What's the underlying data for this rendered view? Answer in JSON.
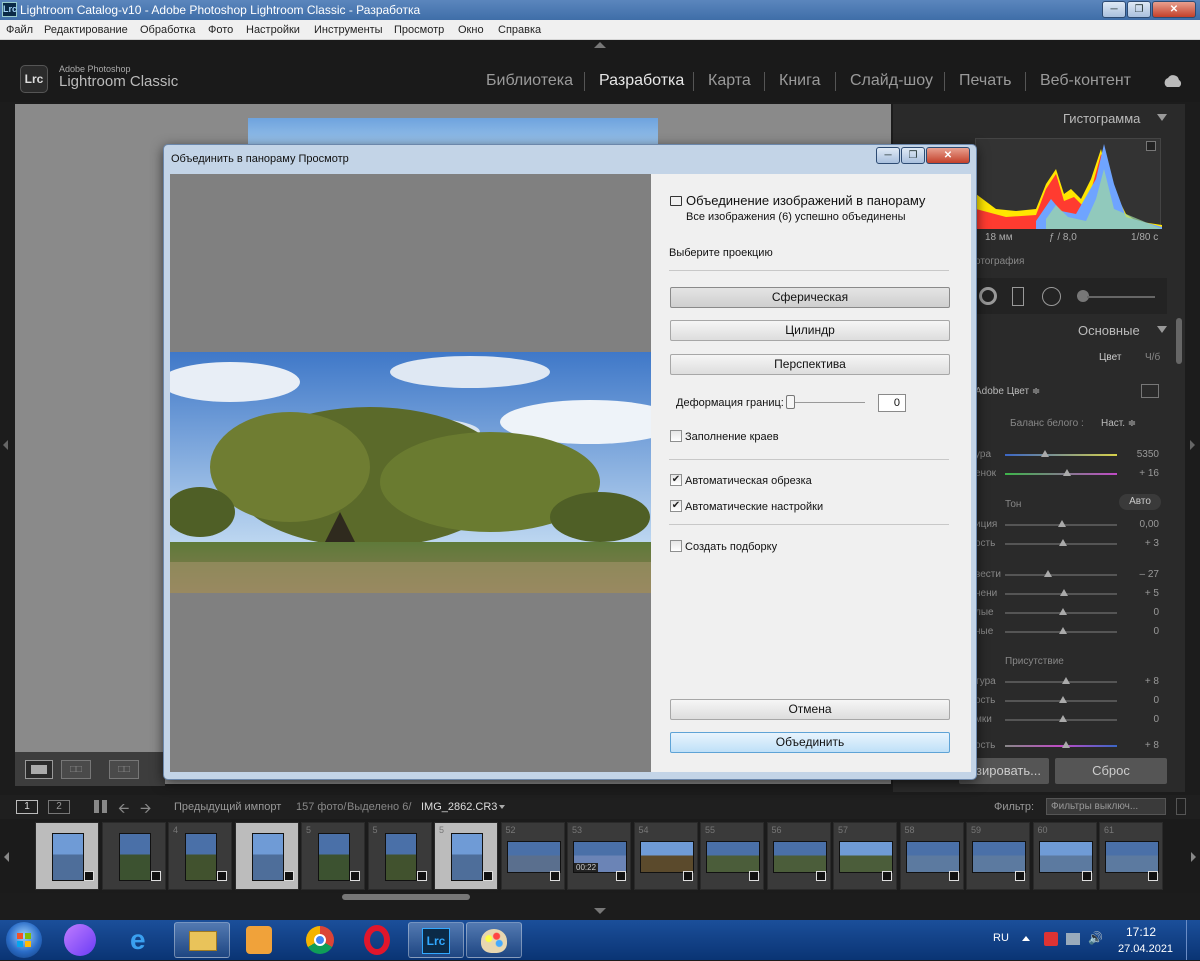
{
  "window": {
    "title": "Lightroom Catalog-v10 - Adobe Photoshop Lightroom Classic - Разработка",
    "app_icon": "Lrc",
    "controls": [
      "minimize",
      "maximize",
      "close"
    ]
  },
  "menu": [
    "Файл",
    "Редактирование",
    "Обработка",
    "Фото",
    "Настройки",
    "Инструменты",
    "Просмотр",
    "Окно",
    "Справка"
  ],
  "header": {
    "logo": "Lrc",
    "brand_small": "Adobe Photoshop",
    "brand_big": "Lightroom Classic",
    "modules": [
      {
        "label": "Библиотека",
        "active": false
      },
      {
        "label": "Разработка",
        "active": true
      },
      {
        "label": "Карта",
        "active": false
      },
      {
        "label": "Книга",
        "active": false
      },
      {
        "label": "Слайд-шоу",
        "active": false
      },
      {
        "label": "Печать",
        "active": false
      },
      {
        "label": "Веб-контент",
        "active": false
      }
    ]
  },
  "right_panel": {
    "histogram_title": "Гистограмма",
    "exif": {
      "focal": "18 мм",
      "aperture": "ƒ / 8,0",
      "shutter": "1/80 с"
    },
    "original_label": "отография",
    "basic_title": "Основные",
    "treatment": {
      "color": "Цвет",
      "bw": "Ч/б"
    },
    "profile": "Adobe Цвет ≑",
    "wb_label": "Баланс белого :",
    "wb_value": "Наст. ≑",
    "temp": {
      "label": "ура",
      "value": "5350"
    },
    "tint": {
      "label": "енок",
      "value": "+ 16"
    },
    "tone_title": "Тон",
    "tone_auto": "Авто",
    "exposure": {
      "label": "иция",
      "value": "0,00"
    },
    "contrast": {
      "label": "ость",
      "value": "+ 3"
    },
    "highlights": {
      "label": "вести",
      "value": "– 27"
    },
    "shadows": {
      "label": "нени",
      "value": "+ 5"
    },
    "whites": {
      "label": "лые",
      "value": "0"
    },
    "blacks": {
      "label": "ные",
      "value": "0"
    },
    "presence_title": "Присутствие",
    "texture": {
      "label": "тура",
      "value": "+ 8"
    },
    "clarity": {
      "label": "ость",
      "value": "0"
    },
    "dehaze": {
      "label": "мки",
      "value": "0"
    },
    "vibrance": {
      "label": "ость",
      "value": "+ 8"
    },
    "btn_prev": "зировать...",
    "btn_reset": "Сброс"
  },
  "filmstrip_bar": {
    "source": "Предыдущий импорт",
    "count": "157 фото/",
    "selected": "Выделено 6/",
    "file": "IMG_2862.CR3",
    "filter_label": "Фильтр:",
    "filter_value": "Фильтры выключ..."
  },
  "filmstrip": [
    {
      "num": "",
      "sel": true
    },
    {
      "num": "",
      "sel": false
    },
    {
      "num": "4",
      "sel": false
    },
    {
      "num": "",
      "sel": true
    },
    {
      "num": "5",
      "sel": false
    },
    {
      "num": "5",
      "sel": false
    },
    {
      "num": "5",
      "sel": true
    },
    {
      "num": "52",
      "sel": false
    },
    {
      "num": "53",
      "sel": false
    },
    {
      "num": "54",
      "sel": false
    },
    {
      "num": "55",
      "sel": false
    },
    {
      "num": "56",
      "sel": false
    },
    {
      "num": "57",
      "sel": false
    },
    {
      "num": "58",
      "sel": false
    },
    {
      "num": "59",
      "sel": false
    },
    {
      "num": "60",
      "sel": false
    },
    {
      "num": "61",
      "sel": false
    }
  ],
  "video_duration": "00:22",
  "dialog": {
    "title": "Объединить в панораму  Просмотр",
    "heading": "Объединение изображений в панораму",
    "status": "Все изображения (6) успешно объединены",
    "projection_label": "Выберите проекцию",
    "projections": [
      {
        "label": "Сферическая",
        "selected": true
      },
      {
        "label": "Цилиндр",
        "selected": false
      },
      {
        "label": "Перспектива",
        "selected": false
      }
    ],
    "warp_label": "Деформация границ:",
    "warp_value": "0",
    "fill_edges": {
      "label": "Заполнение краев",
      "checked": false
    },
    "auto_crop": {
      "label": "Автоматическая обрезка",
      "checked": true
    },
    "auto_settings": {
      "label": "Автоматические настройки",
      "checked": true
    },
    "create_stack": {
      "label": "Создать подборку",
      "checked": false
    },
    "cancel": "Отмена",
    "merge": "Объединить"
  },
  "taskbar": {
    "lang": "RU",
    "time": "17:12",
    "date": "27.04.2021",
    "apps": [
      "start",
      "alice",
      "ie",
      "explorer",
      "media",
      "chrome",
      "opera",
      "lightroom",
      "paint"
    ]
  }
}
